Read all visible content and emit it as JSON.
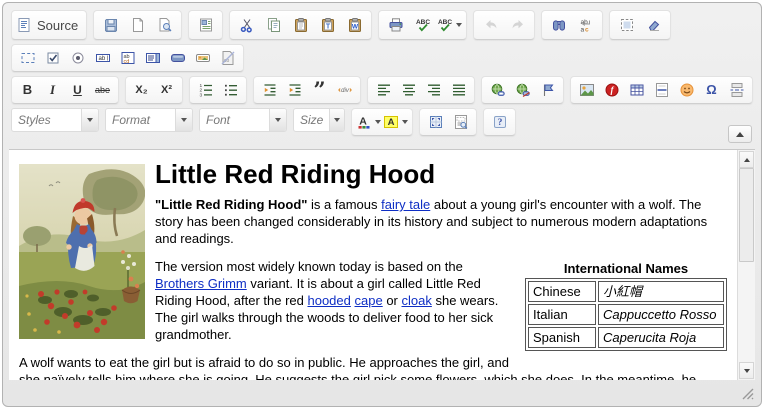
{
  "colors": {
    "link": "#0e2ec4",
    "toolbar_bg": "#e8e8e8",
    "content_bg": "#ffffff",
    "highlight_yellow": "#ffff33"
  },
  "toolbar": {
    "rows": [
      {
        "groups": [
          {
            "type": "group",
            "items": [
              {
                "name": "source",
                "icon": "source-icon",
                "label": "Source"
              }
            ]
          },
          {
            "type": "group",
            "items": [
              {
                "name": "save",
                "icon": "save-icon"
              },
              {
                "name": "new-page",
                "icon": "new-page-icon"
              },
              {
                "name": "preview",
                "icon": "preview-icon"
              }
            ]
          },
          {
            "type": "group",
            "items": [
              {
                "name": "templates",
                "icon": "templates-icon"
              }
            ]
          },
          {
            "type": "group",
            "items": [
              {
                "name": "cut",
                "icon": "cut-icon"
              },
              {
                "name": "copy",
                "icon": "copy-icon"
              },
              {
                "name": "paste",
                "icon": "paste-icon"
              },
              {
                "name": "paste-plain-text",
                "icon": "paste-text-icon"
              },
              {
                "name": "paste-from-word",
                "icon": "paste-word-icon"
              }
            ]
          },
          {
            "type": "group",
            "items": [
              {
                "name": "print",
                "icon": "print-icon"
              },
              {
                "name": "check-spelling",
                "icon": "spellcheck-icon"
              },
              {
                "name": "scayt",
                "icon": "scayt-icon",
                "caret": true
              }
            ]
          },
          {
            "type": "group",
            "items": [
              {
                "name": "undo",
                "icon": "undo-icon",
                "disabled": true
              },
              {
                "name": "redo",
                "icon": "redo-icon",
                "disabled": true
              }
            ]
          },
          {
            "type": "group",
            "items": [
              {
                "name": "find",
                "icon": "find-icon"
              },
              {
                "name": "replace",
                "icon": "replace-icon"
              }
            ]
          },
          {
            "type": "group",
            "items": [
              {
                "name": "select-all",
                "icon": "select-all-icon"
              },
              {
                "name": "remove-format",
                "icon": "remove-format-icon"
              }
            ]
          }
        ]
      },
      {
        "groups": [
          {
            "type": "group",
            "items": [
              {
                "name": "form",
                "icon": "form-icon"
              },
              {
                "name": "checkbox",
                "icon": "checkbox-icon"
              },
              {
                "name": "radio-button",
                "icon": "radio-icon"
              },
              {
                "name": "text-field",
                "icon": "text-field-icon"
              },
              {
                "name": "textarea",
                "icon": "textarea-icon"
              },
              {
                "name": "selection-field",
                "icon": "selection-field-icon"
              },
              {
                "name": "button",
                "icon": "button-icon"
              },
              {
                "name": "image-button",
                "icon": "image-button-icon"
              },
              {
                "name": "hidden-field",
                "icon": "hidden-field-icon"
              }
            ]
          }
        ]
      },
      {
        "groups": [
          {
            "type": "group",
            "items": [
              {
                "name": "bold",
                "icon": "bold-icon"
              },
              {
                "name": "italic",
                "icon": "italic-icon"
              },
              {
                "name": "underline",
                "icon": "underline-icon"
              },
              {
                "name": "strikethrough",
                "icon": "strike-icon"
              }
            ]
          },
          {
            "type": "group",
            "items": [
              {
                "name": "subscript",
                "icon": "subscript-icon"
              },
              {
                "name": "superscript",
                "icon": "superscript-icon"
              }
            ]
          },
          {
            "type": "group",
            "items": [
              {
                "name": "numbered-list",
                "icon": "numbered-list-icon"
              },
              {
                "name": "bulleted-list",
                "icon": "bulleted-list-icon"
              }
            ]
          },
          {
            "type": "group",
            "items": [
              {
                "name": "decrease-indent",
                "icon": "outdent-icon"
              },
              {
                "name": "increase-indent",
                "icon": "indent-icon"
              },
              {
                "name": "blockquote",
                "icon": "blockquote-icon"
              },
              {
                "name": "div-container",
                "icon": "div-icon"
              }
            ]
          },
          {
            "type": "group",
            "items": [
              {
                "name": "align-left",
                "icon": "align-left-icon"
              },
              {
                "name": "align-center",
                "icon": "align-center-icon"
              },
              {
                "name": "align-right",
                "icon": "align-right-icon"
              },
              {
                "name": "justify",
                "icon": "justify-icon"
              }
            ]
          },
          {
            "type": "group",
            "items": [
              {
                "name": "link",
                "icon": "link-icon"
              },
              {
                "name": "unlink",
                "icon": "unlink-icon"
              },
              {
                "name": "anchor",
                "icon": "anchor-icon"
              }
            ]
          },
          {
            "type": "group",
            "items": [
              {
                "name": "image",
                "icon": "image-icon"
              },
              {
                "name": "flash",
                "icon": "flash-icon"
              },
              {
                "name": "table",
                "icon": "table-icon"
              },
              {
                "name": "horizontal-line",
                "icon": "horizontal-line-icon"
              },
              {
                "name": "smiley",
                "icon": "smiley-icon"
              },
              {
                "name": "special-character",
                "icon": "special-char-icon"
              },
              {
                "name": "page-break",
                "icon": "page-break-icon"
              }
            ]
          }
        ]
      },
      {
        "groups": [
          {
            "type": "combo",
            "name": "styles",
            "label": "Styles"
          },
          {
            "type": "combo",
            "name": "format",
            "label": "Format"
          },
          {
            "type": "combo",
            "name": "font",
            "label": "Font"
          },
          {
            "type": "combo",
            "name": "size",
            "label": "Size"
          },
          {
            "type": "group",
            "items": [
              {
                "name": "text-color",
                "icon": "text-color-icon",
                "caret": true
              },
              {
                "name": "background-color",
                "icon": "bg-color-icon",
                "caret": true
              }
            ]
          },
          {
            "type": "group",
            "items": [
              {
                "name": "maximize",
                "icon": "maximize-icon"
              },
              {
                "name": "show-blocks",
                "icon": "show-blocks-icon"
              }
            ]
          },
          {
            "type": "group",
            "items": [
              {
                "name": "about",
                "icon": "about-icon"
              }
            ]
          }
        ]
      }
    ]
  },
  "content": {
    "heading": "Little Red Riding Hood",
    "paragraphs": [
      {
        "segments": [
          {
            "style": "bold",
            "text": "\"Little Red Riding Hood\""
          },
          {
            "style": "plain",
            "text": " is a famous "
          },
          {
            "style": "link",
            "text": "fairy tale"
          },
          {
            "style": "plain",
            "text": " about a young girl's encounter with a wolf. The story has been changed considerably in its history and subject to numerous modern adaptations and readings."
          }
        ]
      },
      {
        "segments": [
          {
            "style": "plain",
            "text": "The version most widely known today is based on the "
          },
          {
            "style": "link",
            "text": "Brothers Grimm"
          },
          {
            "style": "plain",
            "text": " variant. It is about a girl called Little Red Riding Hood, after the red "
          },
          {
            "style": "link",
            "text": "hooded"
          },
          {
            "style": "plain",
            "text": " "
          },
          {
            "style": "link",
            "text": "cape"
          },
          {
            "style": "plain",
            "text": " or "
          },
          {
            "style": "link",
            "text": "cloak"
          },
          {
            "style": "plain",
            "text": " she wears. The girl walks through the woods to deliver food to her sick grandmother."
          }
        ]
      },
      {
        "segments": [
          {
            "style": "plain",
            "text": "A wolf wants to eat the girl but is afraid to do so in public. He approaches the girl, and she naïvely tells him where she is going. He suggests the girl pick some flowers, which she does. In the meantime, he goes to the grandmother's house and gains entry by pretending to be the girl. He swallows the grandmother whole,"
          }
        ]
      }
    ],
    "names_table": {
      "caption": "International Names",
      "rows": [
        [
          "Chinese",
          "小紅帽"
        ],
        [
          "Italian",
          "Cappuccetto Rosso"
        ],
        [
          "Spanish",
          "Caperucita Roja"
        ]
      ]
    }
  }
}
